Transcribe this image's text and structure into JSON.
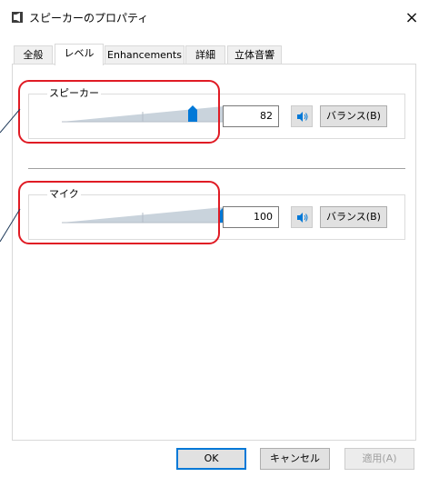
{
  "window": {
    "title": "スピーカーのプロパティ",
    "close_glyph": "×"
  },
  "tabs": [
    {
      "label": "全般",
      "active": false
    },
    {
      "label": "レベル",
      "active": true
    },
    {
      "label": "Enhancements",
      "active": false
    },
    {
      "label": "詳細",
      "active": false
    },
    {
      "label": "立体音響",
      "active": false
    }
  ],
  "levels": {
    "speaker": {
      "label": "スピーカー",
      "value": "82",
      "level": 82,
      "balance_label": "バランス(B)"
    },
    "mic": {
      "label": "マイク",
      "value": "100",
      "level": 100,
      "balance_label": "バランス(B)"
    }
  },
  "buttons": {
    "ok": "OK",
    "cancel": "キャンセル",
    "apply": "適用(A)"
  },
  "colors": {
    "accent": "#0078d7",
    "annotation": "#e01b24",
    "track": "#c9d3dc"
  },
  "icons": {
    "window": "speaker-window-icon",
    "mute": "speaker-volume-icon"
  }
}
